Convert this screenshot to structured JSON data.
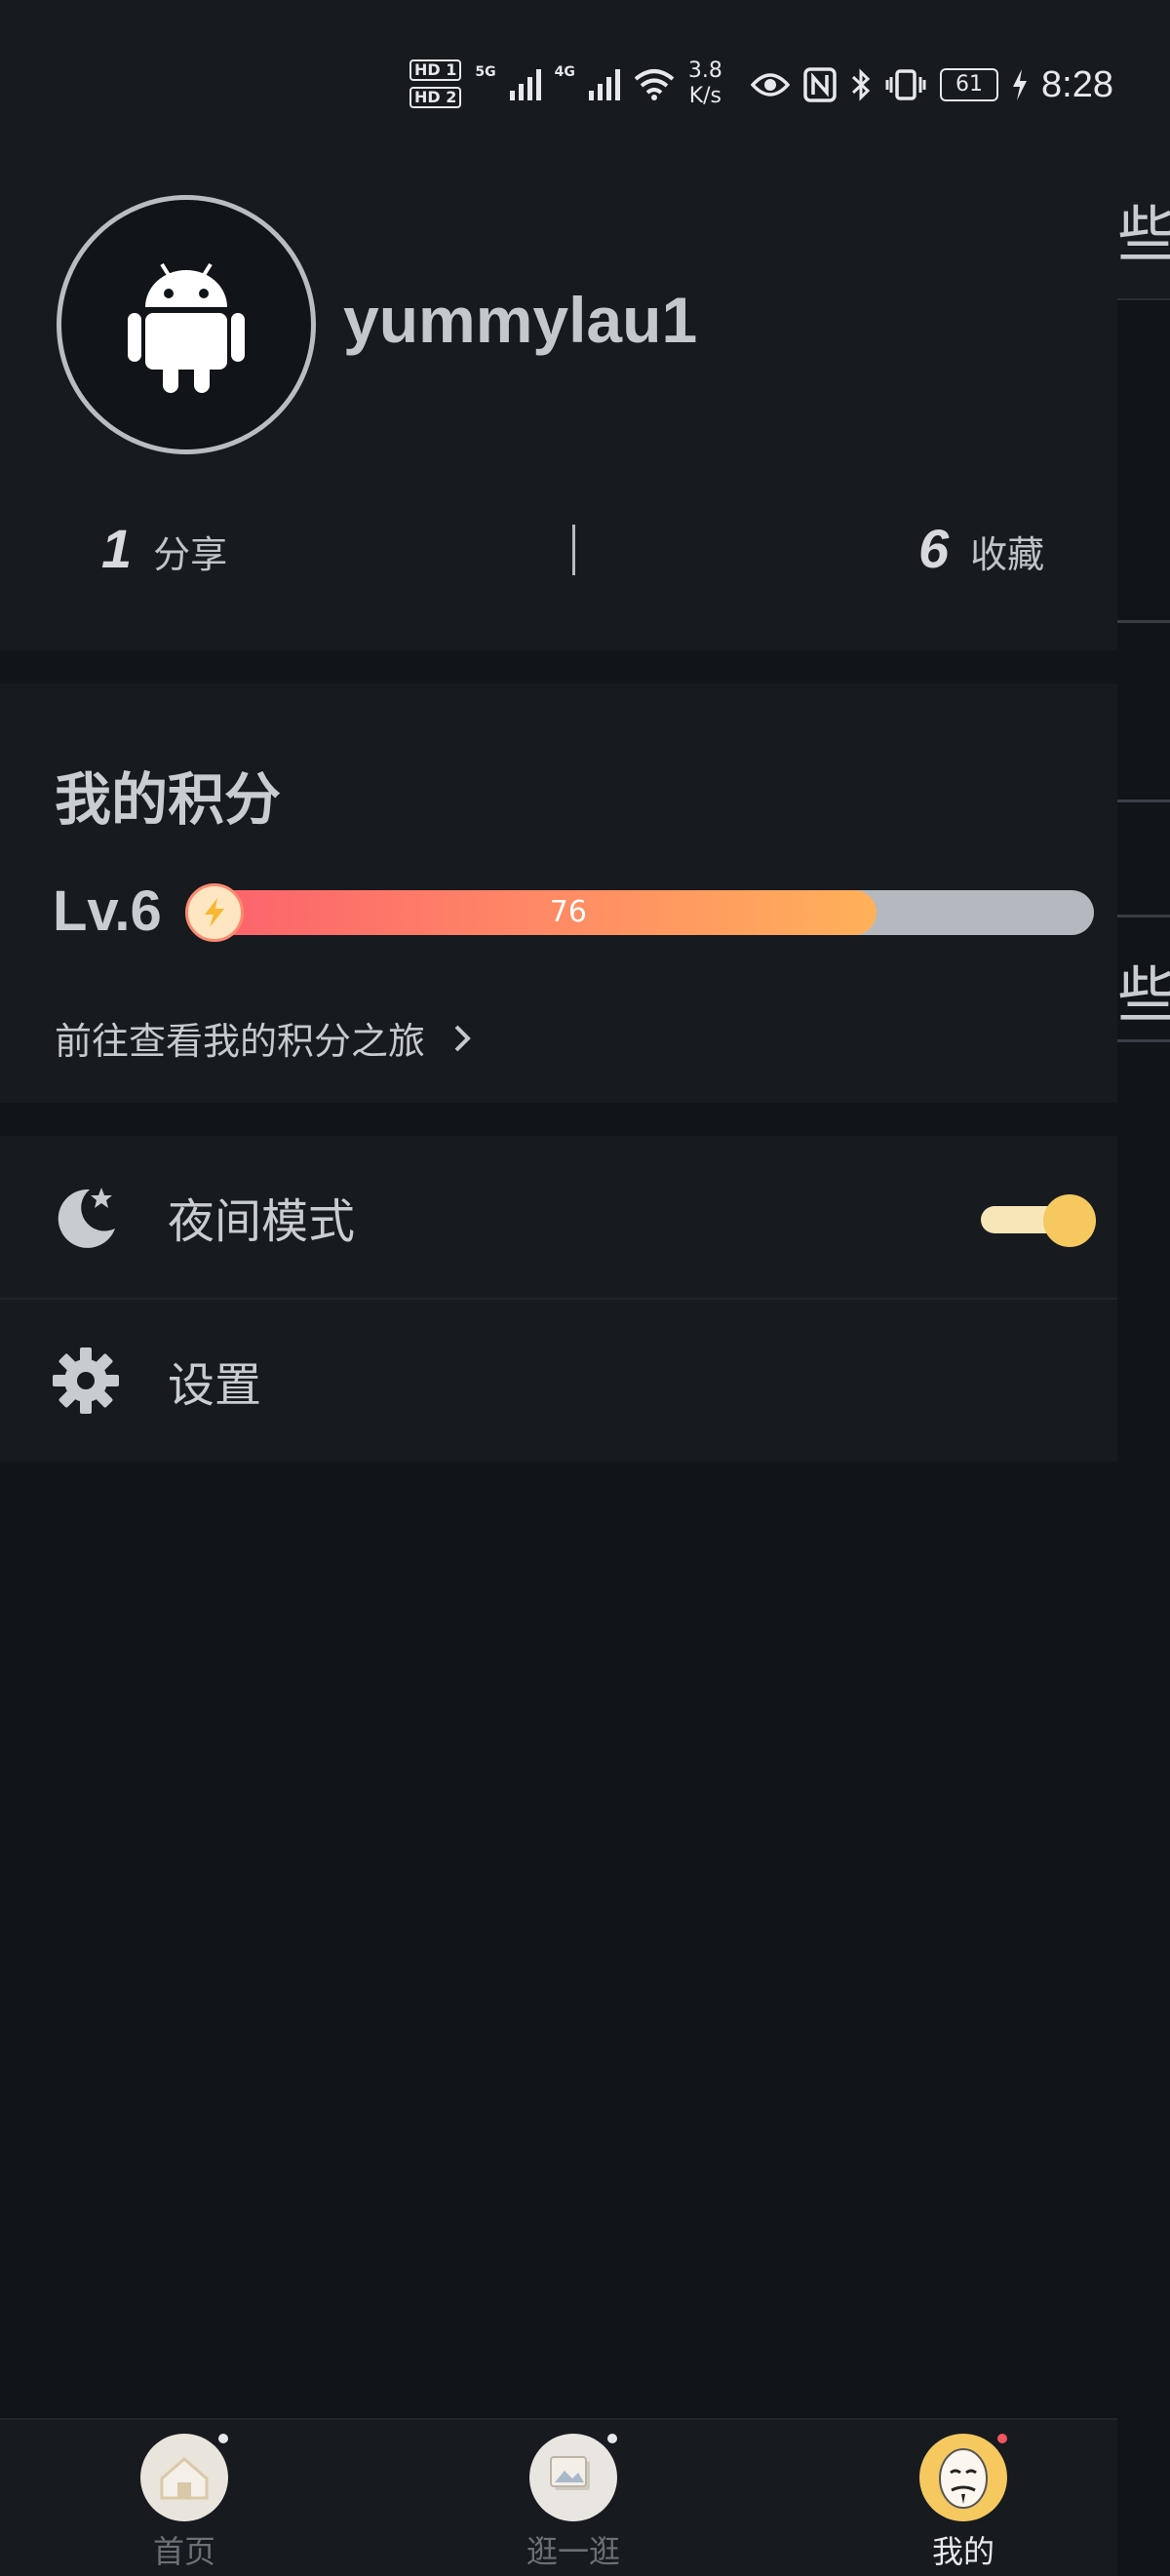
{
  "status_bar": {
    "hd1": "HD 1",
    "hd2": "HD 2",
    "net1": "5G",
    "net2": "4G",
    "speed_value": "3.8",
    "speed_unit": "K/s",
    "battery": "61",
    "time": "8:28"
  },
  "profile": {
    "username": "yummylau1",
    "share_count": "1",
    "share_label": "分享",
    "favorite_count": "6",
    "favorite_label": "收藏"
  },
  "points": {
    "title": "我的积分",
    "level": "Lv.6",
    "progress_value": "76",
    "progress_fraction": 0.76,
    "journey_link": "前往查看我的积分之旅"
  },
  "menu": {
    "night_mode_label": "夜间模式",
    "night_mode_on": true,
    "settings_label": "设置"
  },
  "background_page": {
    "fragment_1": "些阝",
    "fragment_2": "些阝"
  },
  "bottom_nav": [
    {
      "label": "首页",
      "icon": "home-icon",
      "active": false
    },
    {
      "label": "逛一逛",
      "icon": "photos-icon",
      "active": false
    },
    {
      "label": "我的",
      "icon": "mask-avatar-icon",
      "active": true
    }
  ],
  "colors": {
    "accent": "#f5c860",
    "progress_start": "#fb5f6c",
    "progress_end": "#ffb159",
    "nav_active": "#e6e8eb",
    "nav_inactive": "#6b7077"
  }
}
